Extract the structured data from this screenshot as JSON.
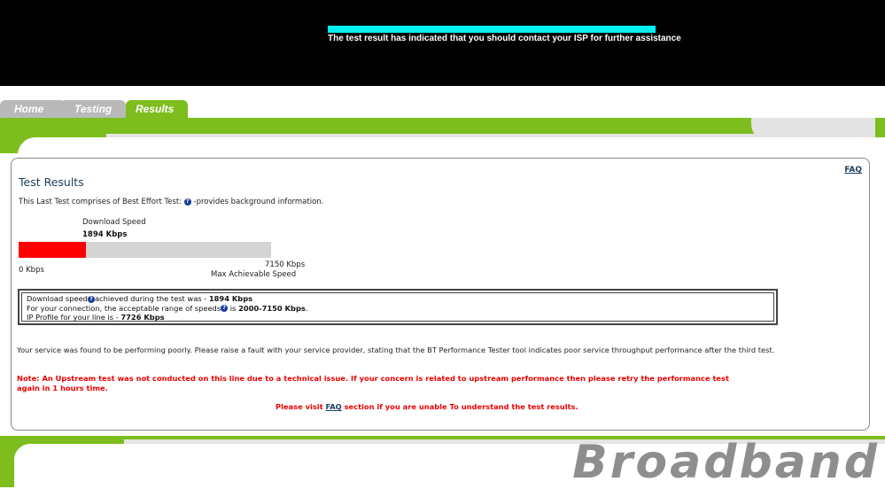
{
  "banner": {
    "message": "The test result has indicated that you should contact your ISP for further assistance"
  },
  "tabs": [
    {
      "label": "Home"
    },
    {
      "label": "Testing"
    },
    {
      "label": "Results"
    }
  ],
  "results": {
    "faq_label": "FAQ",
    "title": "Test Results",
    "intro_before": "This Last Test comprises of Best Effort Test:",
    "intro_after": "-provides background information.",
    "download_label": "Download  Speed",
    "download_speed": "1894 Kbps",
    "speed_fraction": 0.265,
    "min_label": "0 Kbps",
    "max_value": "7150 Kbps",
    "max_label": "Max Achievable Speed",
    "info": {
      "line1_pre": "Download speed",
      "line1_mid": "achieved during the test was - ",
      "line1_val": "1894 Kbps",
      "line2_pre": "For your connection, the acceptable range of speeds",
      "line2_mid": " is ",
      "line2_val": "2000-7150 Kbps",
      "line2_end": ".",
      "line3_pre": "IP Profile for your line is - ",
      "line3_val": "7726 Kbps"
    },
    "performance_message": "Your service was found to be performing poorly. Please raise a fault with your service provider, stating that the BT Performance Tester tool indicates poor service throughput performance after the third test.",
    "note_message": "Note: An Upstream test was not conducted on this line due to a technical issue. If your concern is related to upstream performance then please retry the performance test again in 1 hours time.",
    "visit_pre": "Please visit ",
    "visit_link": "FAQ",
    "visit_post": " section if you are unable To understand the test results."
  },
  "brand": "Broadband",
  "colors": {
    "accent_green": "#7dbd1d",
    "bar_fill": "#ff0000",
    "link": "#1a3d5c"
  }
}
